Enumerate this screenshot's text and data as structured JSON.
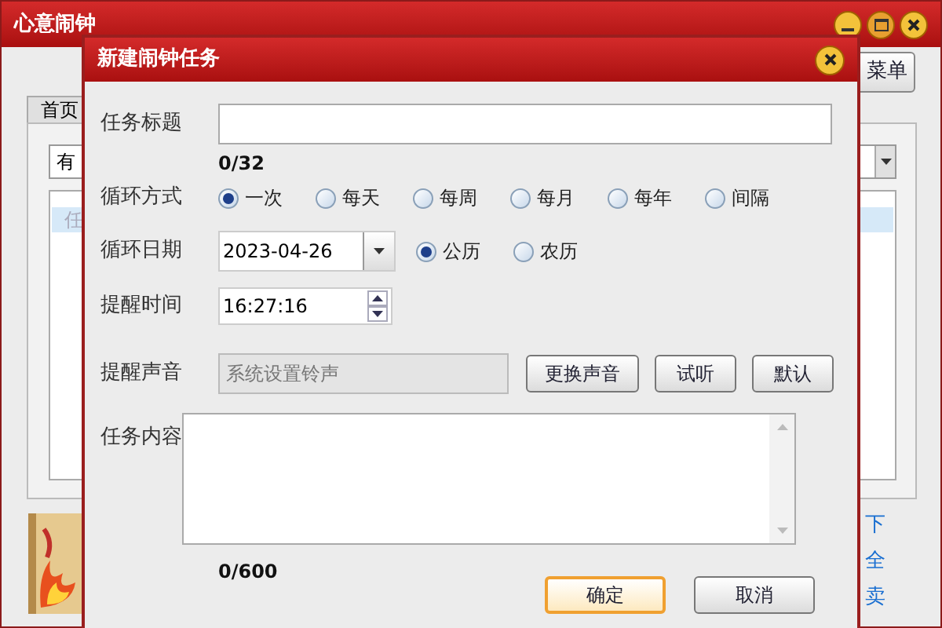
{
  "main_window": {
    "title": "心意闹钟",
    "menu_button": "菜单",
    "tab": "首页",
    "filter_value": "有",
    "list_row": "任",
    "links": [
      "下",
      "全",
      "卖"
    ]
  },
  "dialog": {
    "title": "新建闹钟任务",
    "task_title": {
      "label": "任务标题",
      "counter": "0/32"
    },
    "repeat": {
      "label": "循环方式",
      "options": [
        {
          "label": "一次",
          "selected": true
        },
        {
          "label": "每天",
          "selected": false
        },
        {
          "label": "每周",
          "selected": false
        },
        {
          "label": "每月",
          "selected": false
        },
        {
          "label": "每年",
          "selected": false
        },
        {
          "label": "间隔",
          "selected": false
        }
      ]
    },
    "date": {
      "label": "循环日期",
      "value": "2023-04-26",
      "calendars": [
        {
          "label": "公历",
          "selected": true
        },
        {
          "label": "农历",
          "selected": false
        }
      ]
    },
    "time": {
      "label": "提醒时间",
      "value": "16:27:16"
    },
    "sound": {
      "label": "提醒声音",
      "value": "系统设置铃声",
      "buttons": [
        "更换声音",
        "试听",
        "默认"
      ]
    },
    "content": {
      "label": "任务内容",
      "counter": "0/600"
    },
    "buttons": [
      {
        "label": "确定",
        "default": true
      },
      {
        "label": "取消",
        "default": false
      }
    ]
  }
}
